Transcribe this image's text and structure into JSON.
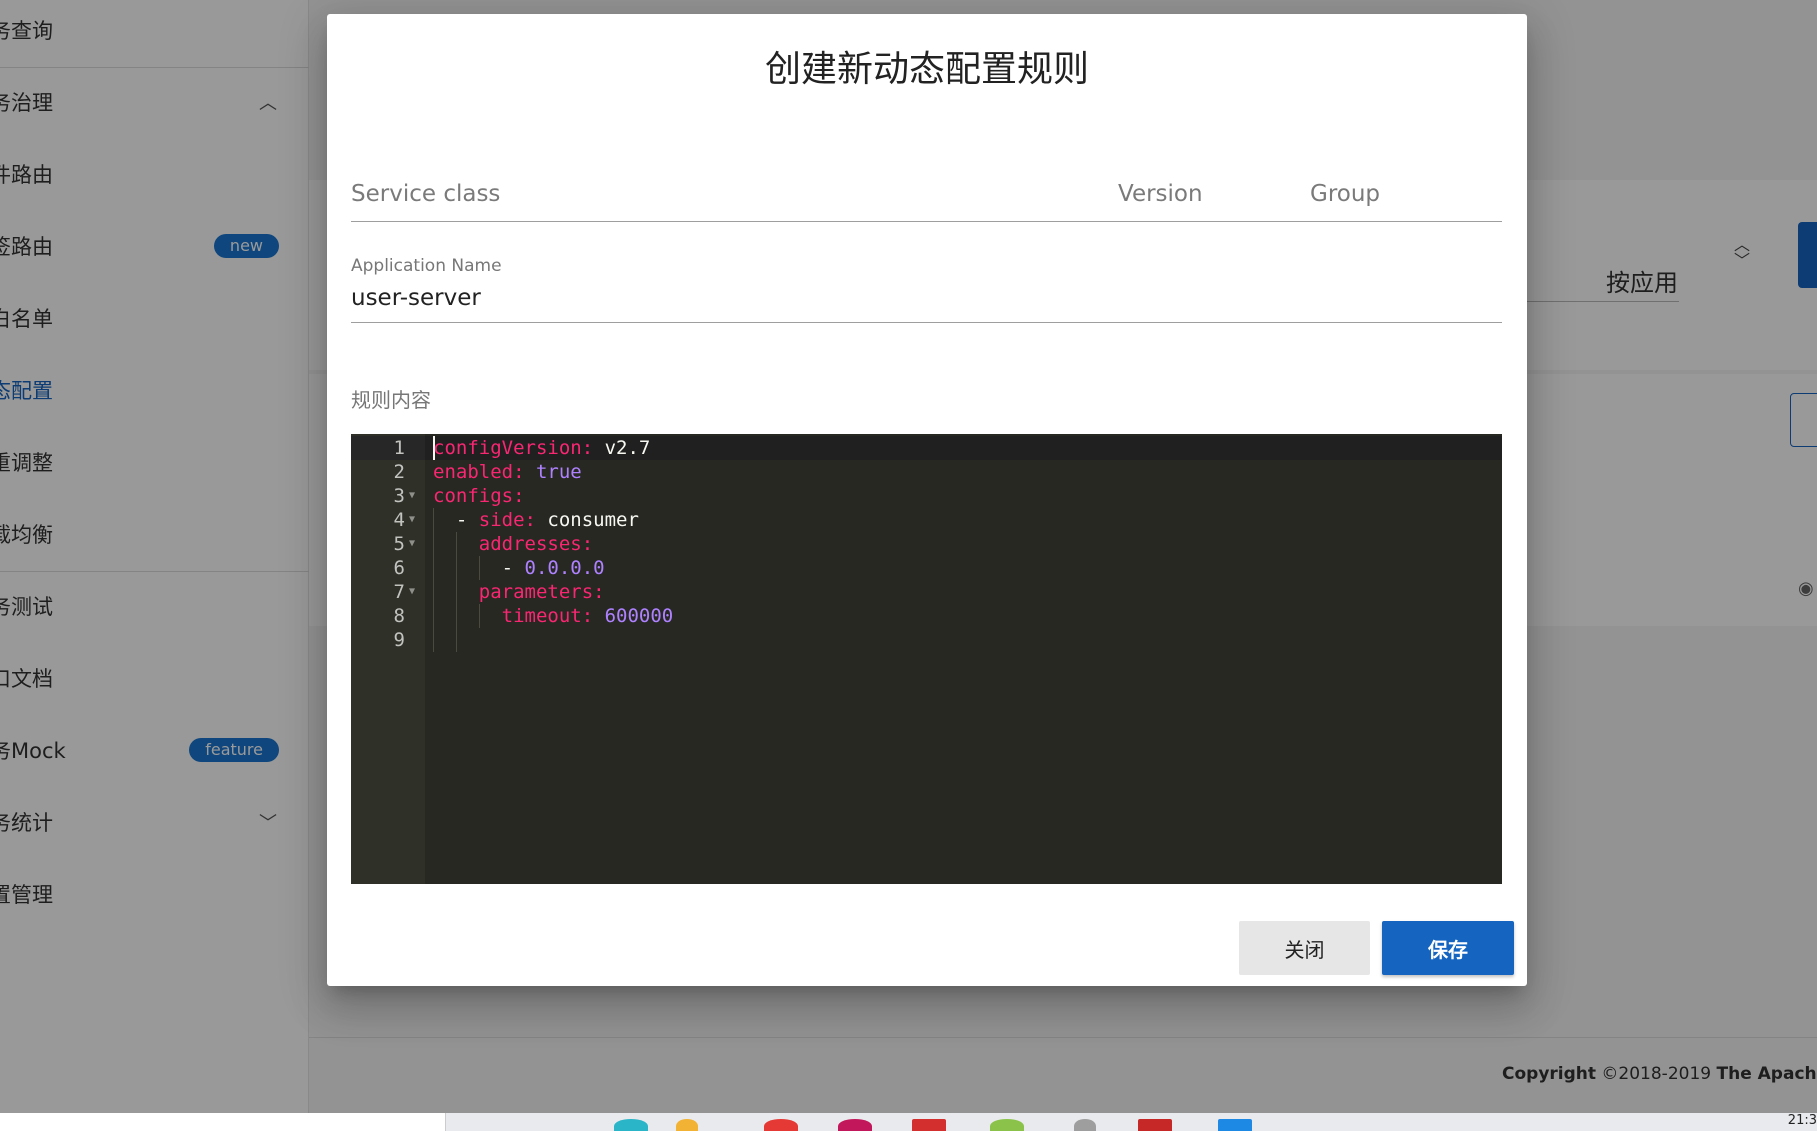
{
  "sidebar": {
    "items": [
      {
        "label": "务查询"
      },
      {
        "label": "务治理"
      },
      {
        "label": "件路由"
      },
      {
        "label": "签路由",
        "badge": "new"
      },
      {
        "label": "白名单"
      },
      {
        "label": "态配置"
      },
      {
        "label": "重调整"
      },
      {
        "label": "载均衡"
      },
      {
        "label": "务测试"
      },
      {
        "label": "口文档"
      },
      {
        "label": "务Mock",
        "badge": "feature"
      },
      {
        "label": "务统计"
      },
      {
        "label": "置管理"
      }
    ]
  },
  "background": {
    "sort_label": "按应用",
    "footer_bold_1": "Copyright",
    "footer_text": " ©2018-2019 ",
    "footer_bold_2": "The Apache Sof",
    "clock": "21:3"
  },
  "dialog": {
    "title": "创建新动态配置规则",
    "service_class_placeholder": "Service class",
    "version_placeholder": "Version",
    "group_placeholder": "Group",
    "application_label": "Application Name",
    "application_value": "user-server",
    "rule_content_label": "规则内容",
    "close_label": "关闭",
    "save_label": "保存"
  },
  "editor": {
    "line_numbers": [
      "1",
      "2",
      "3",
      "4",
      "5",
      "6",
      "7",
      "8",
      "9"
    ],
    "lines": [
      {
        "indent": "",
        "key": "configVersion:",
        "value": " v2.7"
      },
      {
        "indent": "",
        "key": "enabled:",
        "const": " true"
      },
      {
        "indent": "",
        "key": "configs:"
      },
      {
        "indent": "  - ",
        "key": "side:",
        "value": " consumer"
      },
      {
        "indent": "    ",
        "key": "addresses:"
      },
      {
        "indent": "      - ",
        "const": "0.0.0.0"
      },
      {
        "indent": "    ",
        "key": "parameters:"
      },
      {
        "indent": "      ",
        "key": "timeout:",
        "const": " 600000"
      },
      {
        "indent": ""
      }
    ]
  }
}
